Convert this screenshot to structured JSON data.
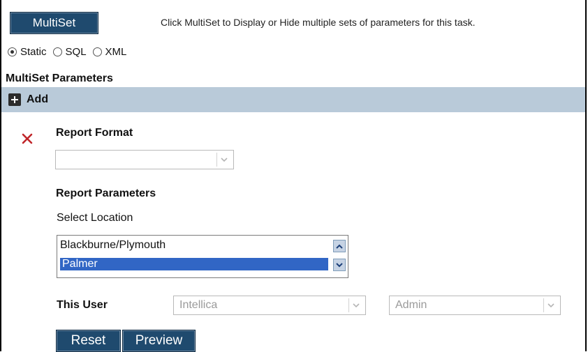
{
  "toolbar": {
    "multiset_label": "MultiSet",
    "hint": "Click MultiSet to Display or Hide multiple sets of parameters for this task."
  },
  "source_options": [
    {
      "label": "Static",
      "selected": true
    },
    {
      "label": "SQL",
      "selected": false
    },
    {
      "label": "XML",
      "selected": false
    }
  ],
  "section": {
    "title": "MultiSet Parameters",
    "add_label": "Add"
  },
  "params": {
    "report_format_label": "Report Format",
    "report_format_value": "",
    "report_parameters_label": "Report Parameters",
    "select_location_label": "Select Location",
    "locations": [
      {
        "label": "Blackburne/Plymouth",
        "selected": false
      },
      {
        "label": "Palmer",
        "selected": true
      }
    ],
    "this_user_label": "This User",
    "user_company": "Intellica",
    "user_role": "Admin"
  },
  "actions": {
    "reset_label": "Reset",
    "preview_label": "Preview"
  },
  "colors": {
    "button_bg": "#1f4a6e",
    "add_bar_bg": "#b9cad9",
    "remove_icon": "#c0262a",
    "selection_bg": "#3166c5"
  }
}
